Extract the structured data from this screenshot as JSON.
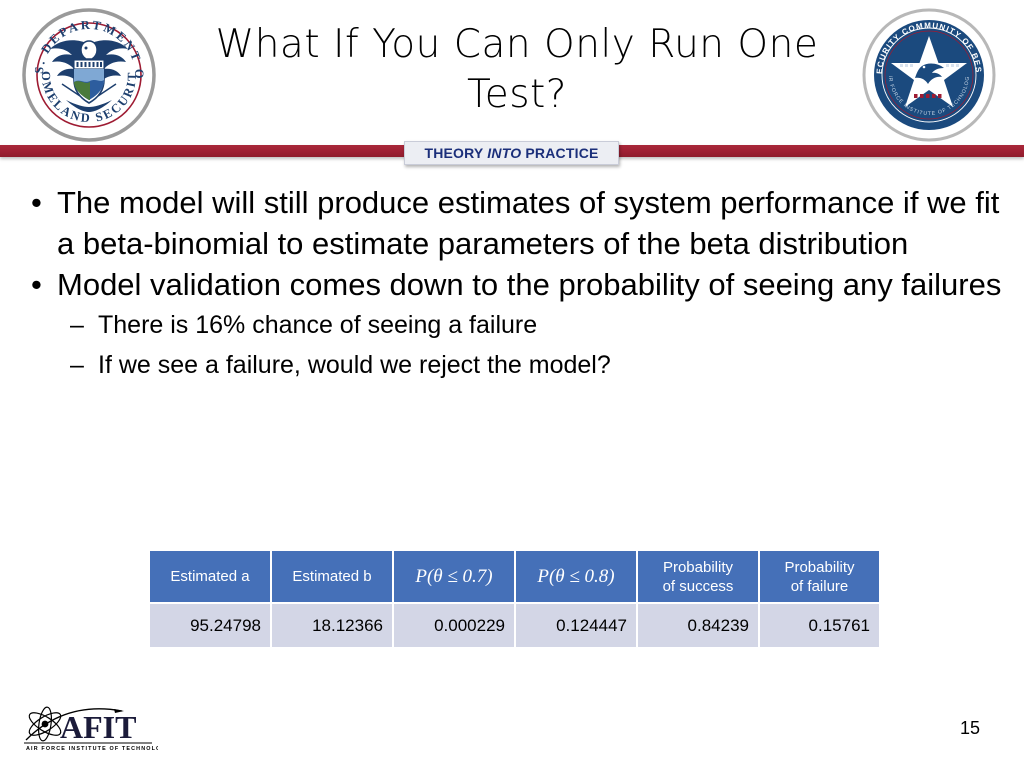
{
  "slide": {
    "title": "What If You Can Only Run One Test?",
    "page_number": "15"
  },
  "header": {
    "left_seal": {
      "icon": "dhs-seal-icon",
      "top_text": "U.S. DEPARTMENT OF",
      "bottom_text": "HOMELAND SECURITY"
    },
    "right_seal": {
      "icon": "hs-community-best-practices-seal-icon",
      "top_text": "HOMELAND SECURITY COMMUNITY OF BEST PRACTICES",
      "bottom_text": "AIR FORCE INSTITUTE OF TECHNOLOGY"
    }
  },
  "banner": {
    "word1": "THEORY",
    "word2": "INTO",
    "word3": "PRACTICE",
    "accent_color": "#1b2f7a",
    "bar_color": "#a9283a"
  },
  "body": {
    "bullets": [
      {
        "level": 1,
        "marker": "•",
        "text": "The model will still produce estimates of system performance if we fit a beta-binomial to estimate parameters of the beta distribution"
      },
      {
        "level": 1,
        "marker": "•",
        "text": "Model validation comes down to the probability of seeing any failures"
      },
      {
        "level": 2,
        "marker": "–",
        "text": "There is 16% chance of seeing a failure"
      },
      {
        "level": 2,
        "marker": "–",
        "text": "If we see a failure, would we reject the model?"
      }
    ]
  },
  "table": {
    "header_bg": "#4570b8",
    "row_bg": "#d3d6e6",
    "columns": [
      {
        "label": "Estimated a",
        "math": false
      },
      {
        "label": "Estimated b",
        "math": false
      },
      {
        "label": "P(θ ≤ 0.7)",
        "math": true,
        "fn": "P",
        "var": "θ",
        "op": "≤",
        "num": "0.7"
      },
      {
        "label": "P(θ ≤ 0.8)",
        "math": true,
        "fn": "P",
        "var": "θ",
        "op": "≤",
        "num": "0.8"
      },
      {
        "label": "Probability\nof success",
        "math": false
      },
      {
        "label": "Probability\nof failure",
        "math": false
      }
    ],
    "rows": [
      [
        "95.24798",
        "18.12366",
        "0.000229",
        "0.124447",
        "0.84239",
        "0.15761"
      ]
    ]
  },
  "footer": {
    "afit_logo": {
      "icon": "afit-logo-icon",
      "wordmark": "AFIT",
      "tagline": "AIR FORCE INSTITUTE OF TECHNOLOGY"
    }
  }
}
